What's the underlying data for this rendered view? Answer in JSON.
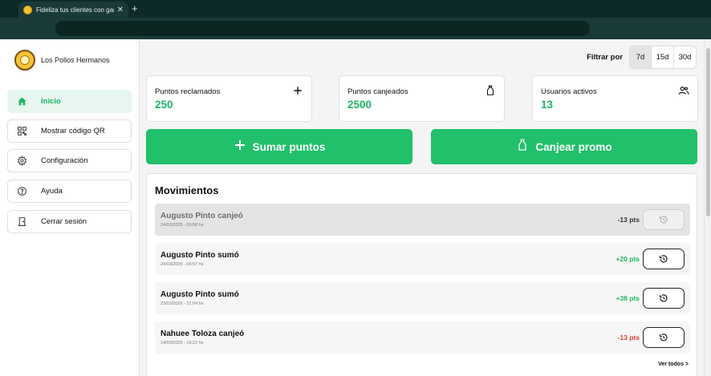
{
  "browser": {
    "tab_title": "Fideliza tus clientes con gamify",
    "tab_close": "✕",
    "new_tab": "+"
  },
  "brand": {
    "name": "Los Pollos Hermanos"
  },
  "sidebar": {
    "items": [
      {
        "label": "Inicio",
        "icon": "home-icon"
      },
      {
        "label": "Mostrar código QR",
        "icon": "qr-code-icon"
      },
      {
        "label": "Configuración",
        "icon": "gear-icon"
      },
      {
        "label": "Ayuda",
        "icon": "help-icon"
      },
      {
        "label": "Cerrar sesión",
        "icon": "logout-icon"
      }
    ]
  },
  "filter": {
    "label": "Filtrar por",
    "options": [
      "7d",
      "15d",
      "30d"
    ],
    "selected": "7d"
  },
  "stats": [
    {
      "label": "Puntos reclamados",
      "value": "250",
      "icon": "plus-icon"
    },
    {
      "label": "Puntos canjeados",
      "value": "2500",
      "icon": "bag-icon"
    },
    {
      "label": "Usuarios activos",
      "value": "13",
      "icon": "users-icon"
    }
  ],
  "actions": {
    "add_points": "Sumar puntos",
    "redeem_promo": "Canjear promo"
  },
  "movements": {
    "title": "Movimientos",
    "rows": [
      {
        "title": "Augusto Pinto canjeó",
        "date": "24/03/2025 - 09:58 hs",
        "points": "-13 pts",
        "disabled": true
      },
      {
        "title": "Augusto Pinto sumó",
        "date": "24/03/2025 - 09:57 hs",
        "points": "+20 pts",
        "disabled": false
      },
      {
        "title": "Augusto Pinto sumó",
        "date": "23/03/2025 - 21:04 hs",
        "points": "+38 pts",
        "disabled": false
      },
      {
        "title": "Nahuee Toloza canjeó",
        "date": "14/03/2025 - 19:22 hs",
        "points": "-13 pts",
        "disabled": false
      }
    ],
    "see_all": "Ver todos >"
  },
  "colors": {
    "accent": "#21c06b",
    "positive": "#1fb563",
    "negative": "#e03b2f",
    "muted": "#6e6e6e"
  }
}
